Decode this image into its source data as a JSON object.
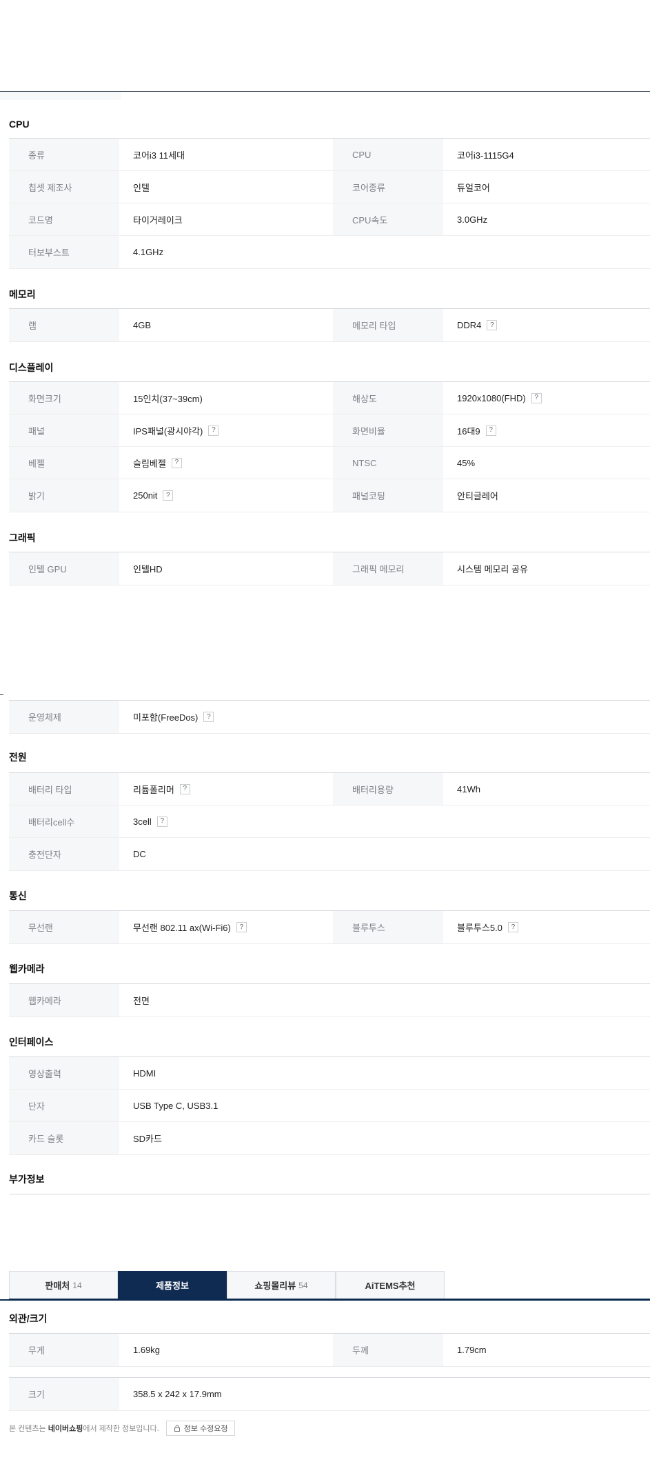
{
  "sections_top": [
    {
      "title": "CPU",
      "rows": [
        {
          "l1": "종류",
          "v1": "코어i3 11세대",
          "l2": "CPU",
          "v2": "코어i3-1115G4"
        },
        {
          "l1": "칩셋 제조사",
          "v1": "인텔",
          "l2": "코어종류",
          "v2": "듀얼코어"
        },
        {
          "l1": "코드명",
          "v1": "타이거레이크",
          "l2": "CPU속도",
          "v2": "3.0GHz"
        },
        {
          "l1": "터보부스트",
          "v1": "4.1GHz",
          "l2": "",
          "v2": ""
        }
      ]
    },
    {
      "title": "메모리",
      "rows": [
        {
          "l1": "램",
          "v1": "4GB",
          "l2": "메모리 타입",
          "v2": "DDR4"
        }
      ]
    },
    {
      "title": "디스플레이",
      "rows": [
        {
          "l1": "화면크기",
          "v1": "15인치(37~39cm)",
          "l2": "해상도",
          "v2": "1920x1080(FHD)"
        },
        {
          "l1": "패널",
          "v1": "IPS패널(광시야각)",
          "l2": "화면비율",
          "v2": "16대9"
        },
        {
          "l1": "베젤",
          "v1": "슬림베젤",
          "l2": "NTSC",
          "v2": "45%"
        },
        {
          "l1": "밝기",
          "v1": "250nit",
          "l2": "패널코팅",
          "v2": "안티글레어"
        }
      ]
    },
    {
      "title": "그래픽",
      "rows": [
        {
          "l1": "인텔 GPU",
          "v1": "인텔HD",
          "l2": "그래픽 메모리",
          "v2": "시스템 메모리 공유"
        }
      ]
    }
  ],
  "os_row": {
    "l1": "운영체제",
    "v1": "미포함(FreeDos)"
  },
  "sections_bottom": [
    {
      "title": "전원",
      "rows": [
        {
          "l1": "배터리 타입",
          "v1": "리튬폴리머",
          "l2": "배터리용량",
          "v2": "41Wh"
        },
        {
          "l1": "배터리cell수",
          "v1": "3cell",
          "l2": "",
          "v2": ""
        },
        {
          "l1": "충전단자",
          "v1": "DC",
          "l2": "",
          "v2": ""
        }
      ]
    },
    {
      "title": "통신",
      "rows": [
        {
          "l1": "무선랜",
          "v1": "무선랜 802.11 ax(Wi-Fi6)",
          "l2": "블루투스",
          "v2": "블루투스5.0"
        }
      ]
    },
    {
      "title": "웹카메라",
      "rows": [
        {
          "l1": "웹카메라",
          "v1": "전면",
          "l2": "",
          "v2": ""
        }
      ]
    },
    {
      "title": "인터페이스",
      "rows": [
        {
          "l1": "영상출력",
          "v1": "HDMI",
          "l2": "",
          "v2": ""
        },
        {
          "l1": "단자",
          "v1": "USB Type C, USB3.1",
          "l2": "",
          "v2": ""
        },
        {
          "l1": "카드 슬롯",
          "v1": "SD카드",
          "l2": "",
          "v2": ""
        }
      ]
    }
  ],
  "extra_title": "부가정보",
  "tabs": [
    {
      "label": "판매처",
      "count": "14"
    },
    {
      "label": "제품정보",
      "count": ""
    },
    {
      "label": "쇼핑몰리뷰",
      "count": "54"
    },
    {
      "label": "AiTEMS추천",
      "count": ""
    }
  ],
  "exterior": {
    "title": "외관/크기",
    "row1": {
      "l1": "무게",
      "v1": "1.69kg",
      "l2": "두께",
      "v2": "1.79cm"
    },
    "row2": {
      "l1": "크기",
      "v1": "358.5 x 242 x 17.9mm"
    }
  },
  "footer": {
    "prefix": "본 컨텐츠는",
    "brand": "네이버쇼핑",
    "suffix": "에서 제작한 정보입니다.",
    "request_button": "정보 수정요청"
  }
}
